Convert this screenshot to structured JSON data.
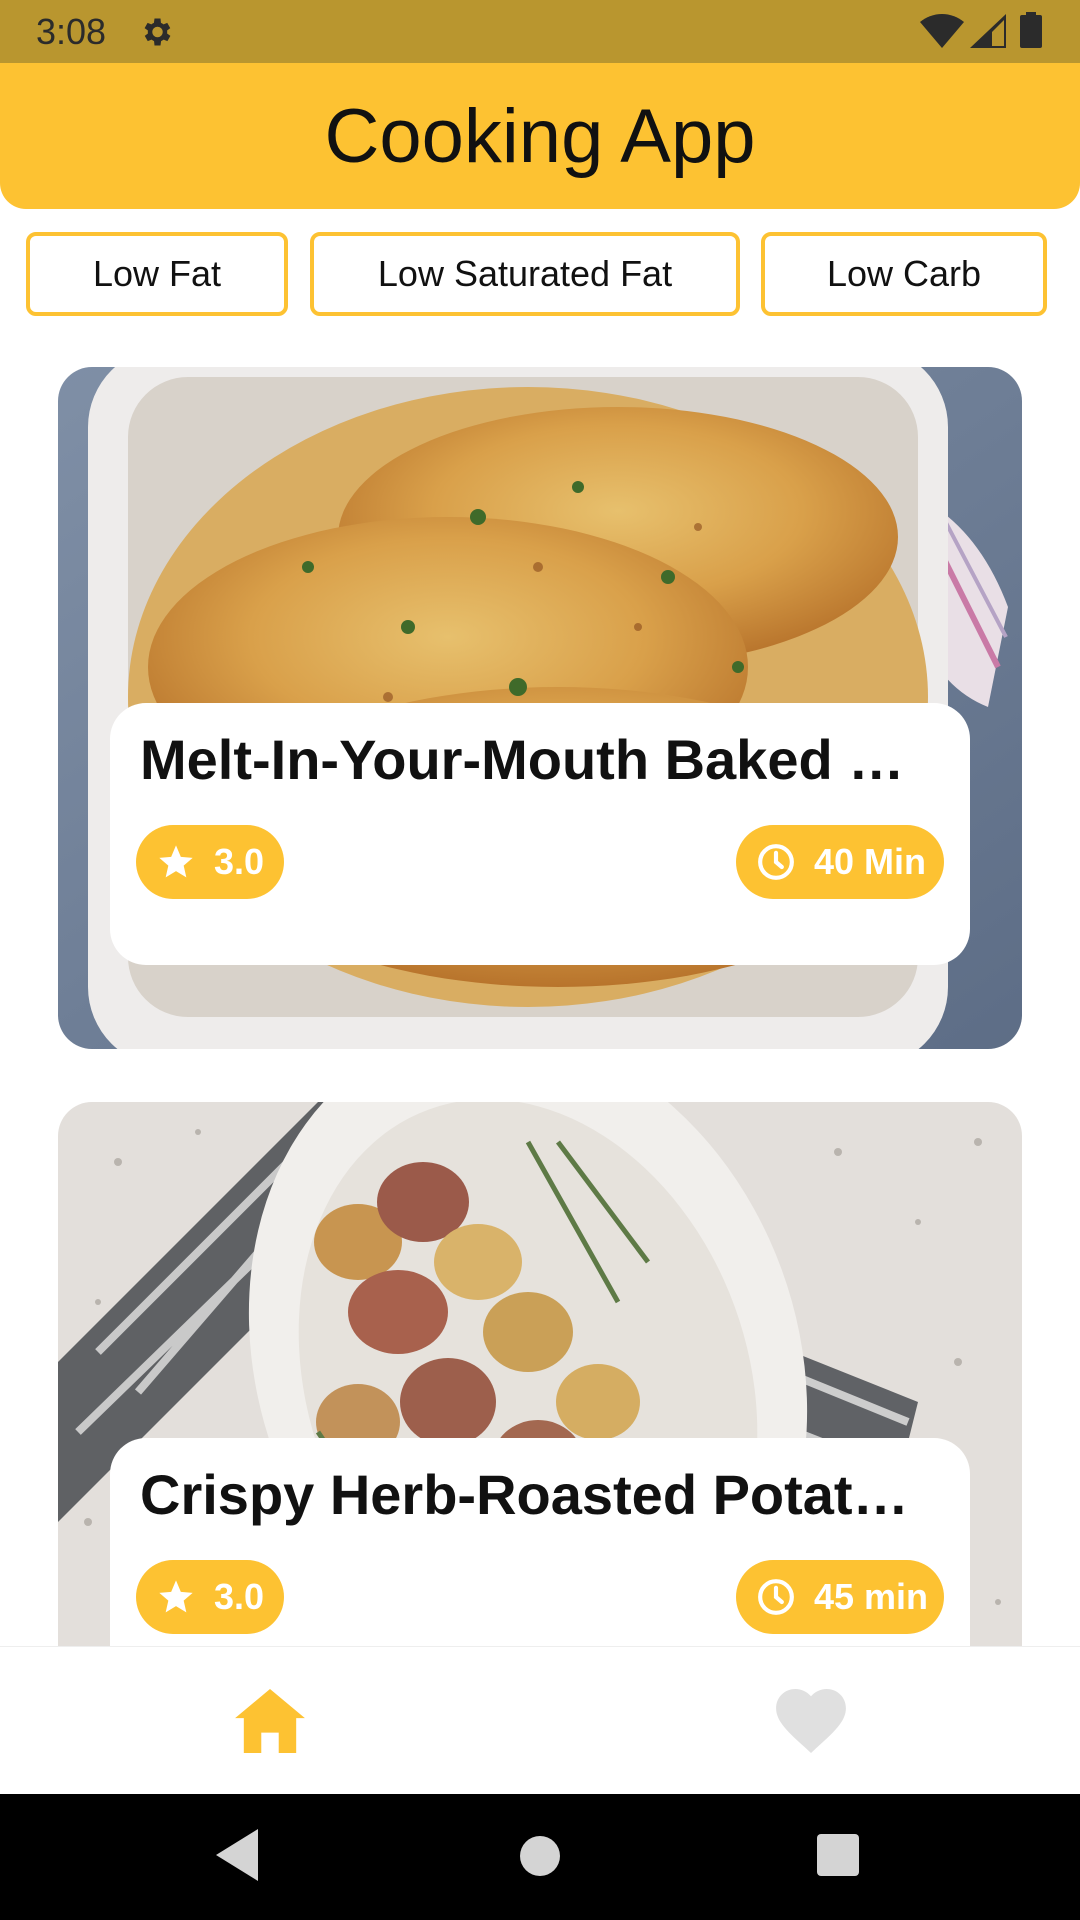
{
  "status_bar": {
    "time": "3:08",
    "icons": [
      "gear-icon",
      "wifi-icon",
      "signal-icon",
      "battery-icon"
    ]
  },
  "app_bar": {
    "title": "Cooking App"
  },
  "filters": [
    {
      "label": "Low Fat"
    },
    {
      "label": "Low Saturated Fat"
    },
    {
      "label": "Low Carb"
    }
  ],
  "recipes": [
    {
      "title": "Melt-In-Your-Mouth Baked Chicken",
      "rating": "3.0",
      "time": "40 Min"
    },
    {
      "title": "Crispy Herb-Roasted Potatoes",
      "rating": "3.0",
      "time": "45 min"
    }
  ],
  "bottom_nav": {
    "items": [
      {
        "icon": "home-icon",
        "active": true
      },
      {
        "icon": "heart-icon",
        "active": false
      }
    ]
  },
  "colors": {
    "accent": "#fdc232",
    "status_bar": "#b9962f",
    "inactive_icon": "#e0e0e0"
  }
}
